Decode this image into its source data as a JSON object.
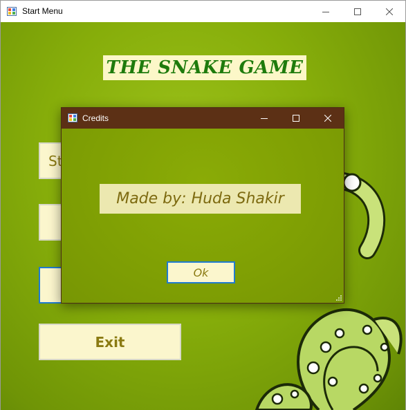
{
  "main_window": {
    "title": "Start Menu",
    "icon": "app-icon"
  },
  "game": {
    "title": "THE SNAKE GAME",
    "title_color": "#1e7b0c"
  },
  "menu": {
    "buttons": [
      {
        "label": "St"
      },
      {
        "label": ""
      },
      {
        "label": ""
      },
      {
        "label": "Exit"
      }
    ]
  },
  "dialog": {
    "title": "Credits",
    "message": "Made by: Huda Shakir",
    "ok_label": "Ok",
    "title_bar_color": "#5c3015"
  },
  "colors": {
    "background_green": "#86ad0a",
    "button_cream": "#fbf6cd",
    "focus_blue": "#1f7bd0"
  }
}
